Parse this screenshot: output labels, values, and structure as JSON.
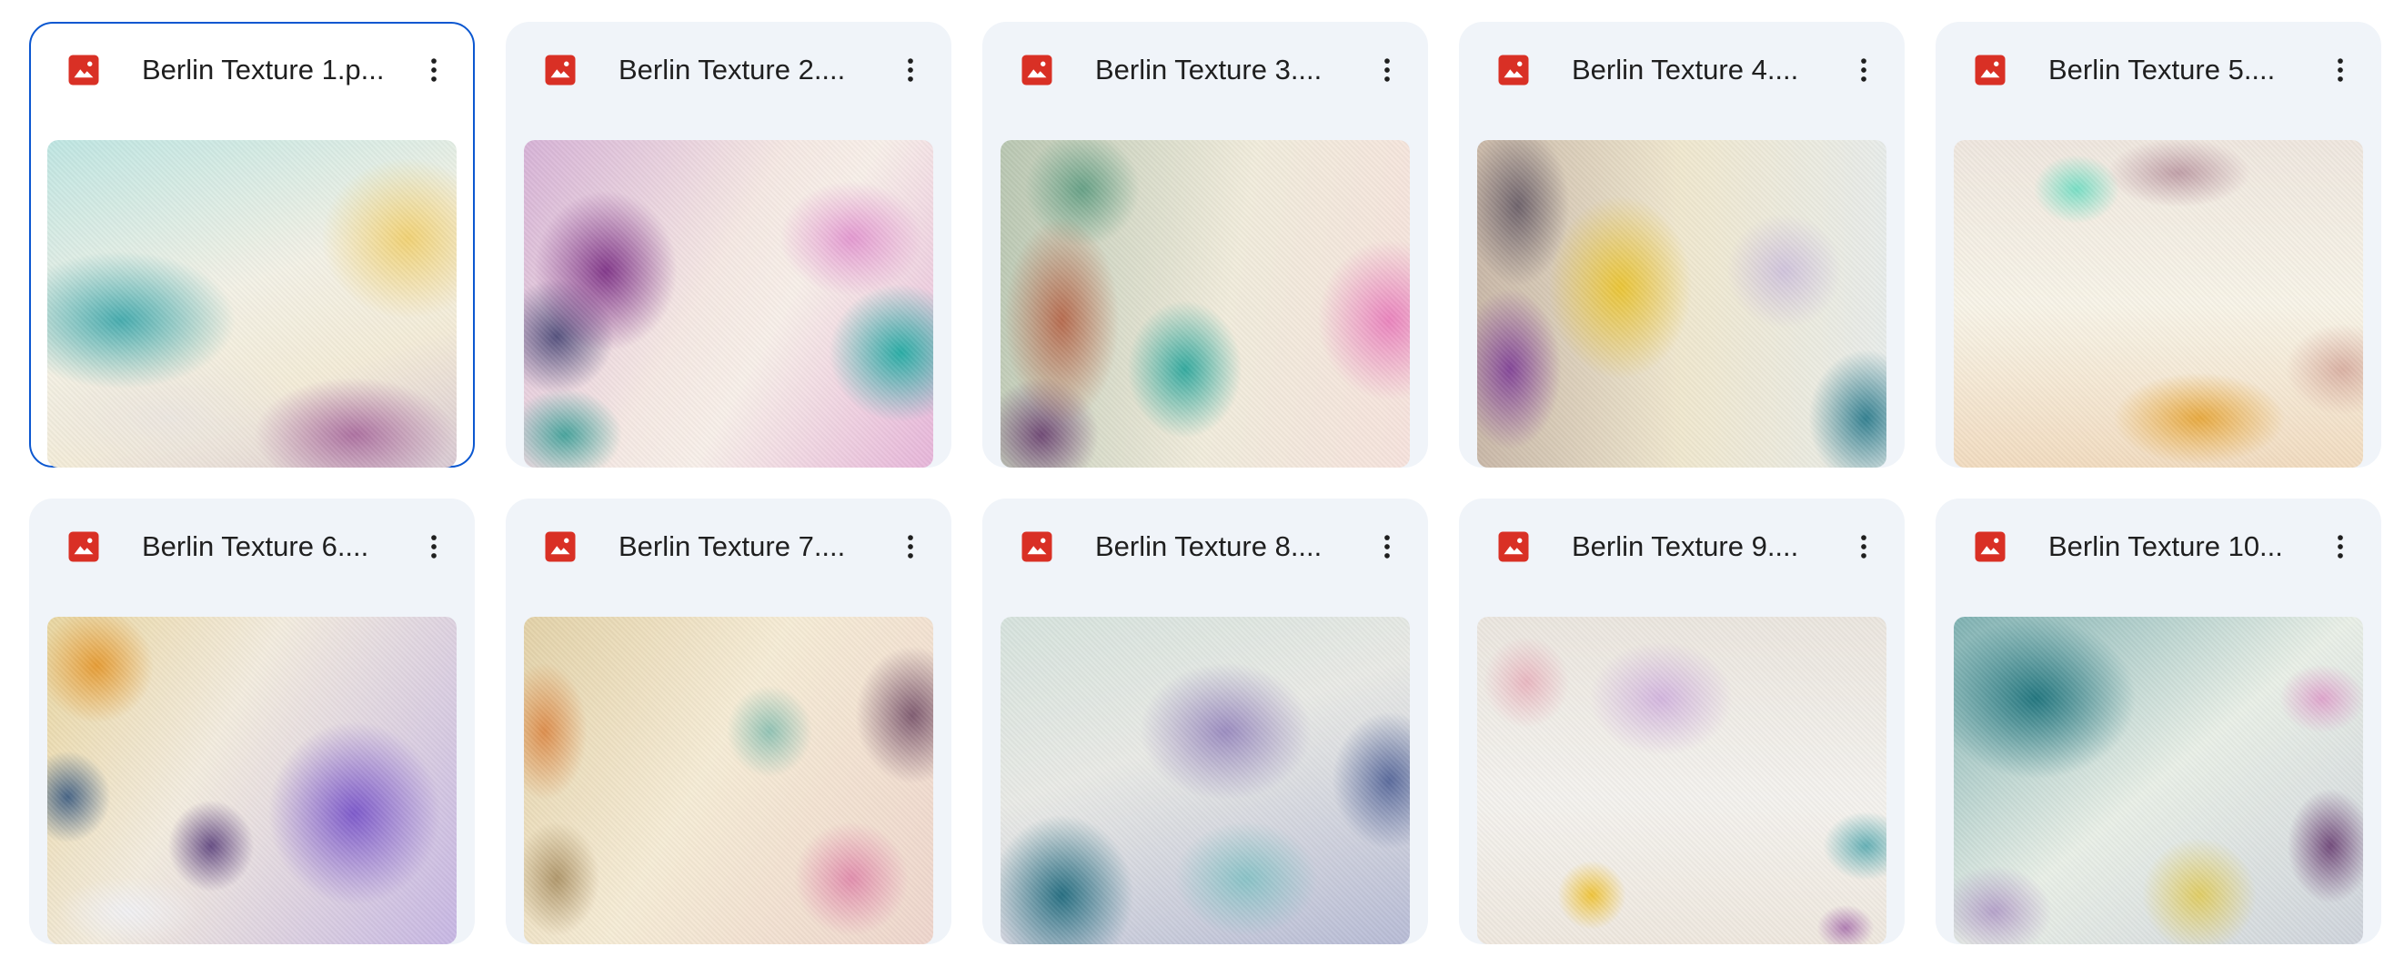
{
  "colors": {
    "file_icon": "#d93025",
    "card_background": "#f0f4f9",
    "selected_border": "#0b57d0",
    "text": "#1f1f1f"
  },
  "icons": {
    "file_type": "image-file-icon",
    "menu": "more-vert-icon"
  },
  "files": [
    {
      "name": "Berlin Texture 1.p...",
      "selected": true,
      "texture": "tex1"
    },
    {
      "name": "Berlin Texture 2....",
      "selected": false,
      "texture": "tex2"
    },
    {
      "name": "Berlin Texture 3....",
      "selected": false,
      "texture": "tex3"
    },
    {
      "name": "Berlin Texture 4....",
      "selected": false,
      "texture": "tex4"
    },
    {
      "name": "Berlin Texture 5....",
      "selected": false,
      "texture": "tex5"
    },
    {
      "name": "Berlin Texture 6....",
      "selected": false,
      "texture": "tex6"
    },
    {
      "name": "Berlin Texture 7....",
      "selected": false,
      "texture": "tex7"
    },
    {
      "name": "Berlin Texture 8....",
      "selected": false,
      "texture": "tex8"
    },
    {
      "name": "Berlin Texture 9....",
      "selected": false,
      "texture": "tex9"
    },
    {
      "name": "Berlin Texture 10...",
      "selected": false,
      "texture": "tex10"
    }
  ]
}
